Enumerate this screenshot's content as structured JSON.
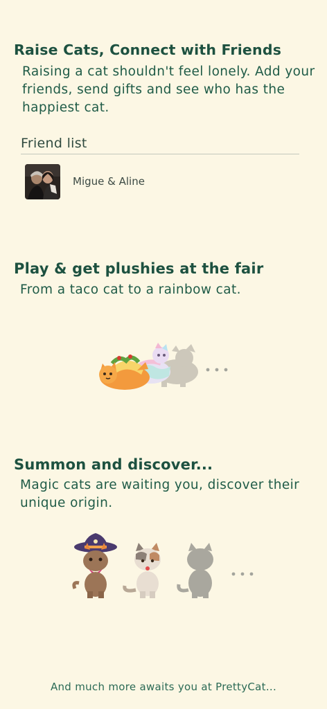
{
  "section_social": {
    "heading": "Raise Cats, Connect with Friends",
    "text": "Raising a cat shouldn't feel lonely. Add your friends, send gifts and see who has the happiest cat.",
    "friend_list_label": "Friend list",
    "friends": [
      {
        "name": "Migue & Aline",
        "avatar": "couple-photo-avatar"
      }
    ]
  },
  "section_fair": {
    "heading": "Play & get plushies at the fair",
    "text": "From a taco cat to a rainbow cat.",
    "plushies": [
      "taco-cat-plushie",
      "rainbow-cat-plushie",
      "locked-cat-plushie"
    ],
    "more": "..."
  },
  "section_summon": {
    "heading": "Summon and discover...",
    "text": "Magic cats are waiting you, discover their unique origin.",
    "cats": [
      "witch-cat",
      "calico-cat",
      "locked-cat-silhouette"
    ],
    "more": "..."
  },
  "footer": {
    "text": "And much more awaits you at PrettyCat..."
  },
  "colors": {
    "background": "#fcf7e4",
    "heading": "#1d5140",
    "text": "#1f5b47"
  }
}
